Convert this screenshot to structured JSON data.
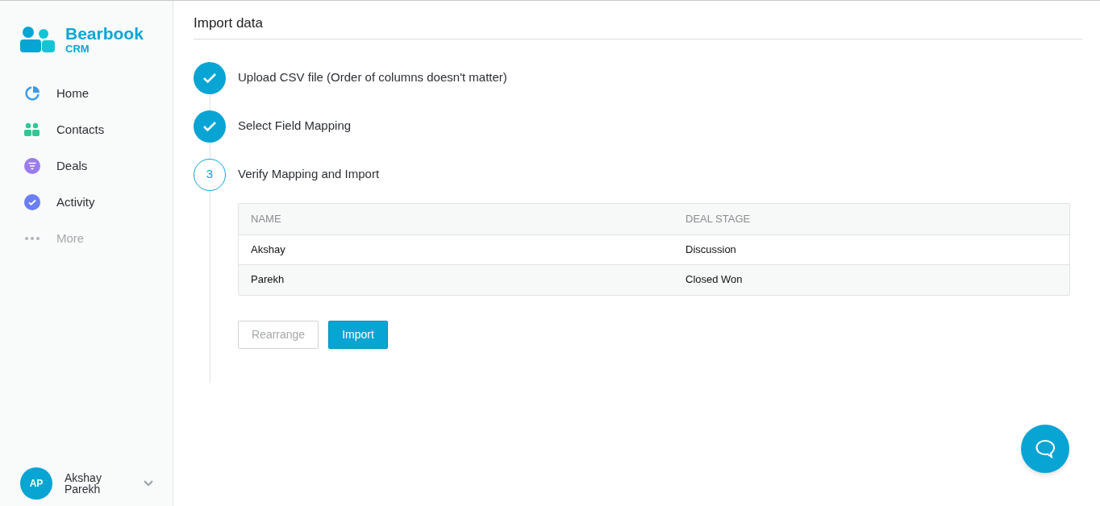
{
  "brand": {
    "name": "Bearbook",
    "sub": "CRM"
  },
  "nav": [
    {
      "kind": "home",
      "label": "Home",
      "disabled": false
    },
    {
      "kind": "contacts",
      "label": "Contacts",
      "disabled": false
    },
    {
      "kind": "deals",
      "label": "Deals",
      "disabled": false
    },
    {
      "kind": "activity",
      "label": "Activity",
      "disabled": false
    },
    {
      "kind": "more",
      "label": "More",
      "disabled": true
    }
  ],
  "user": {
    "initials": "AP",
    "name": "Akshay Parekh"
  },
  "page_title": "Import data",
  "steps": [
    {
      "label": "Upload CSV file (Order of columns doesn't matter)",
      "done": true
    },
    {
      "label": "Select Field Mapping",
      "done": true
    },
    {
      "label": "Verify Mapping and Import",
      "done": false,
      "number": "3"
    }
  ],
  "table": {
    "columns": [
      "NAME",
      "DEAL STAGE"
    ],
    "rows": [
      [
        "Akshay",
        "Discussion"
      ],
      [
        "Parekh",
        "Closed Won"
      ]
    ]
  },
  "buttons": [
    {
      "label": "Rearrange",
      "kind": "secondary",
      "disabled": true
    },
    {
      "label": "Import",
      "kind": "primary",
      "disabled": false
    }
  ]
}
